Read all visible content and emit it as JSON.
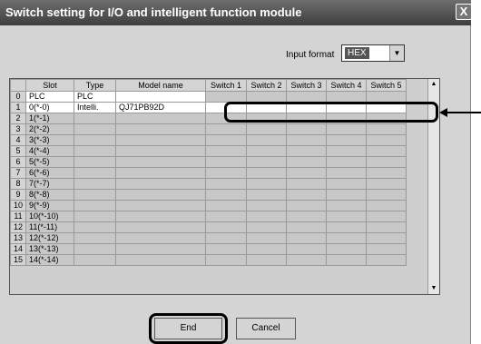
{
  "window": {
    "title": "Switch setting for I/O and intelligent function module",
    "close_glyph": "X"
  },
  "input_format": {
    "label": "Input format",
    "value": "HEX"
  },
  "table": {
    "headers": [
      "",
      "Slot",
      "Type",
      "Model name",
      "Switch 1",
      "Switch 2",
      "Switch 3",
      "Switch 4",
      "Switch 5"
    ],
    "rows": [
      {
        "num": "0",
        "slot": "PLC",
        "type": "PLC",
        "model": ""
      },
      {
        "num": "1",
        "slot": "0(*-0)",
        "type": "Intelli.",
        "model": "QJ71PB92D"
      },
      {
        "num": "2",
        "slot": "1(*-1)",
        "type": "",
        "model": ""
      },
      {
        "num": "3",
        "slot": "2(*-2)",
        "type": "",
        "model": ""
      },
      {
        "num": "4",
        "slot": "3(*-3)",
        "type": "",
        "model": ""
      },
      {
        "num": "5",
        "slot": "4(*-4)",
        "type": "",
        "model": ""
      },
      {
        "num": "6",
        "slot": "5(*-5)",
        "type": "",
        "model": ""
      },
      {
        "num": "7",
        "slot": "6(*-6)",
        "type": "",
        "model": ""
      },
      {
        "num": "8",
        "slot": "7(*-7)",
        "type": "",
        "model": ""
      },
      {
        "num": "9",
        "slot": "8(*-8)",
        "type": "",
        "model": ""
      },
      {
        "num": "10",
        "slot": "9(*-9)",
        "type": "",
        "model": ""
      },
      {
        "num": "11",
        "slot": "10(*-10)",
        "type": "",
        "model": ""
      },
      {
        "num": "12",
        "slot": "11(*-11)",
        "type": "",
        "model": ""
      },
      {
        "num": "13",
        "slot": "12(*-12)",
        "type": "",
        "model": ""
      },
      {
        "num": "14",
        "slot": "13(*-13)",
        "type": "",
        "model": ""
      },
      {
        "num": "15",
        "slot": "14(*-14)",
        "type": "",
        "model": ""
      }
    ]
  },
  "buttons": {
    "end": "End",
    "cancel": "Cancel"
  },
  "icons": {
    "scroll_up": "▲",
    "scroll_down": "▼",
    "dropdown": "▼"
  }
}
